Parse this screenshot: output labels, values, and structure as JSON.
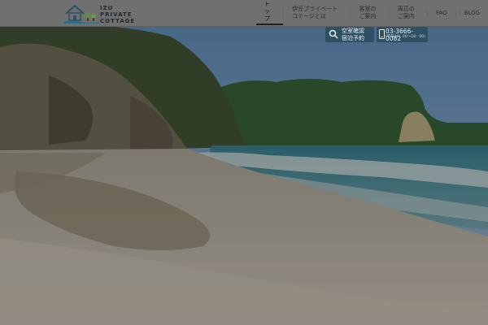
{
  "logo": {
    "lines": [
      "IZU",
      "PRIVATE",
      "COTTAGE"
    ]
  },
  "nav": {
    "items": [
      {
        "label": "トップ"
      },
      {
        "label": "伊豆プライベートコテージとは"
      },
      {
        "label": "客室のご案内"
      },
      {
        "label": "周辺のご案内"
      },
      {
        "label": "FAQ"
      },
      {
        "label": "BLOG"
      }
    ]
  },
  "reservation_button": {
    "line1": "空室確認",
    "line2": "宿泊予約"
  },
  "phone_button": {
    "number": "03-3666-0082",
    "hours": "(平日10：00～18：00)"
  },
  "colors": {
    "header_bg": "#707070",
    "button_bg": "#2e5063",
    "sea": "#3f6e80"
  }
}
